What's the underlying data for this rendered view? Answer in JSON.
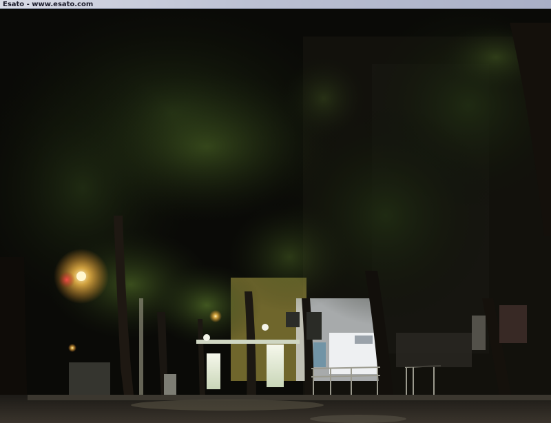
{
  "window": {
    "title": "Esato - www.esato.com"
  },
  "scene": {
    "palette": {
      "sky": "#0b0b08",
      "foliage_dark": "#13160b",
      "foliage_lit": "#4f6a23",
      "trunk": "#1b1610",
      "street_lamp": "#ffcc55",
      "shelter_light": "#f3f6e6",
      "road": "#2a2622"
    }
  }
}
